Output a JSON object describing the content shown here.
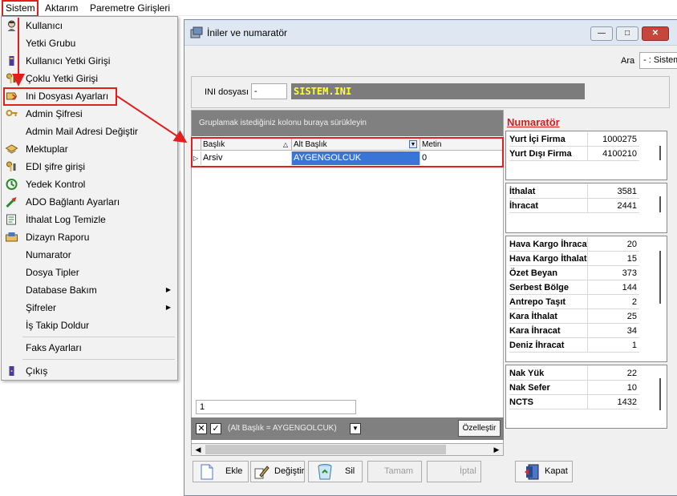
{
  "menubar": {
    "items": [
      "Sistem",
      "Aktarım",
      "Paremetre Girişleri"
    ]
  },
  "dropdown": {
    "items": [
      {
        "label": "Kullanıcı",
        "icon": "user-icon"
      },
      {
        "label": "Yetki Grubu",
        "icon": ""
      },
      {
        "label": "Kullanıcı Yetki Girişi",
        "icon": "user-key-icon"
      },
      {
        "label": "Çoklu Yetki Girişi",
        "icon": "keys-icon"
      },
      {
        "label": "Ini Dosyası  Ayarları",
        "icon": "ini-settings-icon"
      },
      {
        "label": "Admin Şifresi",
        "icon": "key-icon"
      },
      {
        "label": "Admin Mail Adresi Değiştir",
        "icon": ""
      },
      {
        "label": "Mektuplar",
        "icon": "mail-icon"
      },
      {
        "label": "EDI şifre girişi",
        "icon": "key-icon"
      },
      {
        "label": "Yedek Kontrol",
        "icon": "backup-icon"
      },
      {
        "label": "ADO Bağlantı Ayarları",
        "icon": "connection-icon"
      },
      {
        "label": "İthalat Log Temizle",
        "icon": "log-clean-icon"
      },
      {
        "label": "Dizayn Raporu",
        "icon": "report-icon"
      },
      {
        "label": "Numarator",
        "icon": ""
      },
      {
        "label": "Dosya Tipler",
        "icon": ""
      },
      {
        "label": "Database Bakım",
        "icon": "",
        "submenu": true
      },
      {
        "label": "Şifreler",
        "icon": "",
        "submenu": true
      },
      {
        "label": "İş Takip Doldur",
        "icon": ""
      },
      {
        "label": "Faks Ayarları",
        "icon": ""
      },
      {
        "label": "Çıkış",
        "icon": "exit-icon"
      }
    ]
  },
  "window": {
    "title": "İniler ve numaratör",
    "ara_label": "Ara",
    "ara_value": "- : Sistem",
    "ini_label": "INI dosyası",
    "ini_input": "-",
    "ini_value": "SISTEM.INI"
  },
  "grid": {
    "group_hint": "Gruplamak istediğiniz kolonu buraya sürükleyin",
    "columns": [
      "Başlık",
      "Alt Başlık",
      "Metin"
    ],
    "rows": [
      [
        "Arsiv",
        "AYGENGOLCUK",
        "0"
      ]
    ],
    "row_count": "1",
    "filter_text": "(Alt Başlık = AYGENGOLCUK)",
    "customize_label": "Özelleştir"
  },
  "numarator": {
    "title": "Numaratör",
    "groups": [
      [
        [
          "Yurt İçi Firma",
          "1000275"
        ],
        [
          "Yurt Dışı Firma",
          "4100210"
        ]
      ],
      [
        [
          "İthalat",
          "3581"
        ],
        [
          "İhracat",
          "2441"
        ]
      ],
      [
        [
          "Hava Kargo İhracat",
          "20"
        ],
        [
          "Hava Kargo İthalat",
          "15"
        ],
        [
          "Özet Beyan",
          "373"
        ],
        [
          "Serbest Bölge",
          "144"
        ],
        [
          "Antrepo Taşıt",
          "2"
        ],
        [
          "Kara İthalat",
          "25"
        ],
        [
          "Kara İhracat",
          "34"
        ],
        [
          "Deniz İhracat",
          "1"
        ]
      ],
      [
        [
          "Nak Yük",
          "22"
        ],
        [
          "Nak Sefer",
          "10"
        ],
        [
          "NCTS",
          "1432"
        ]
      ]
    ]
  },
  "buttons": {
    "ekle": "Ekle",
    "degistir": "Değiştir",
    "sil": "Sil",
    "tamam": "Tamam",
    "iptal": "İptal",
    "kapat": "Kapat"
  },
  "colors": {
    "highlight": "#e21e1e",
    "selection": "#3875d7",
    "ini_value_text": "#ffff33",
    "numarator_title": "#d91b1b"
  }
}
